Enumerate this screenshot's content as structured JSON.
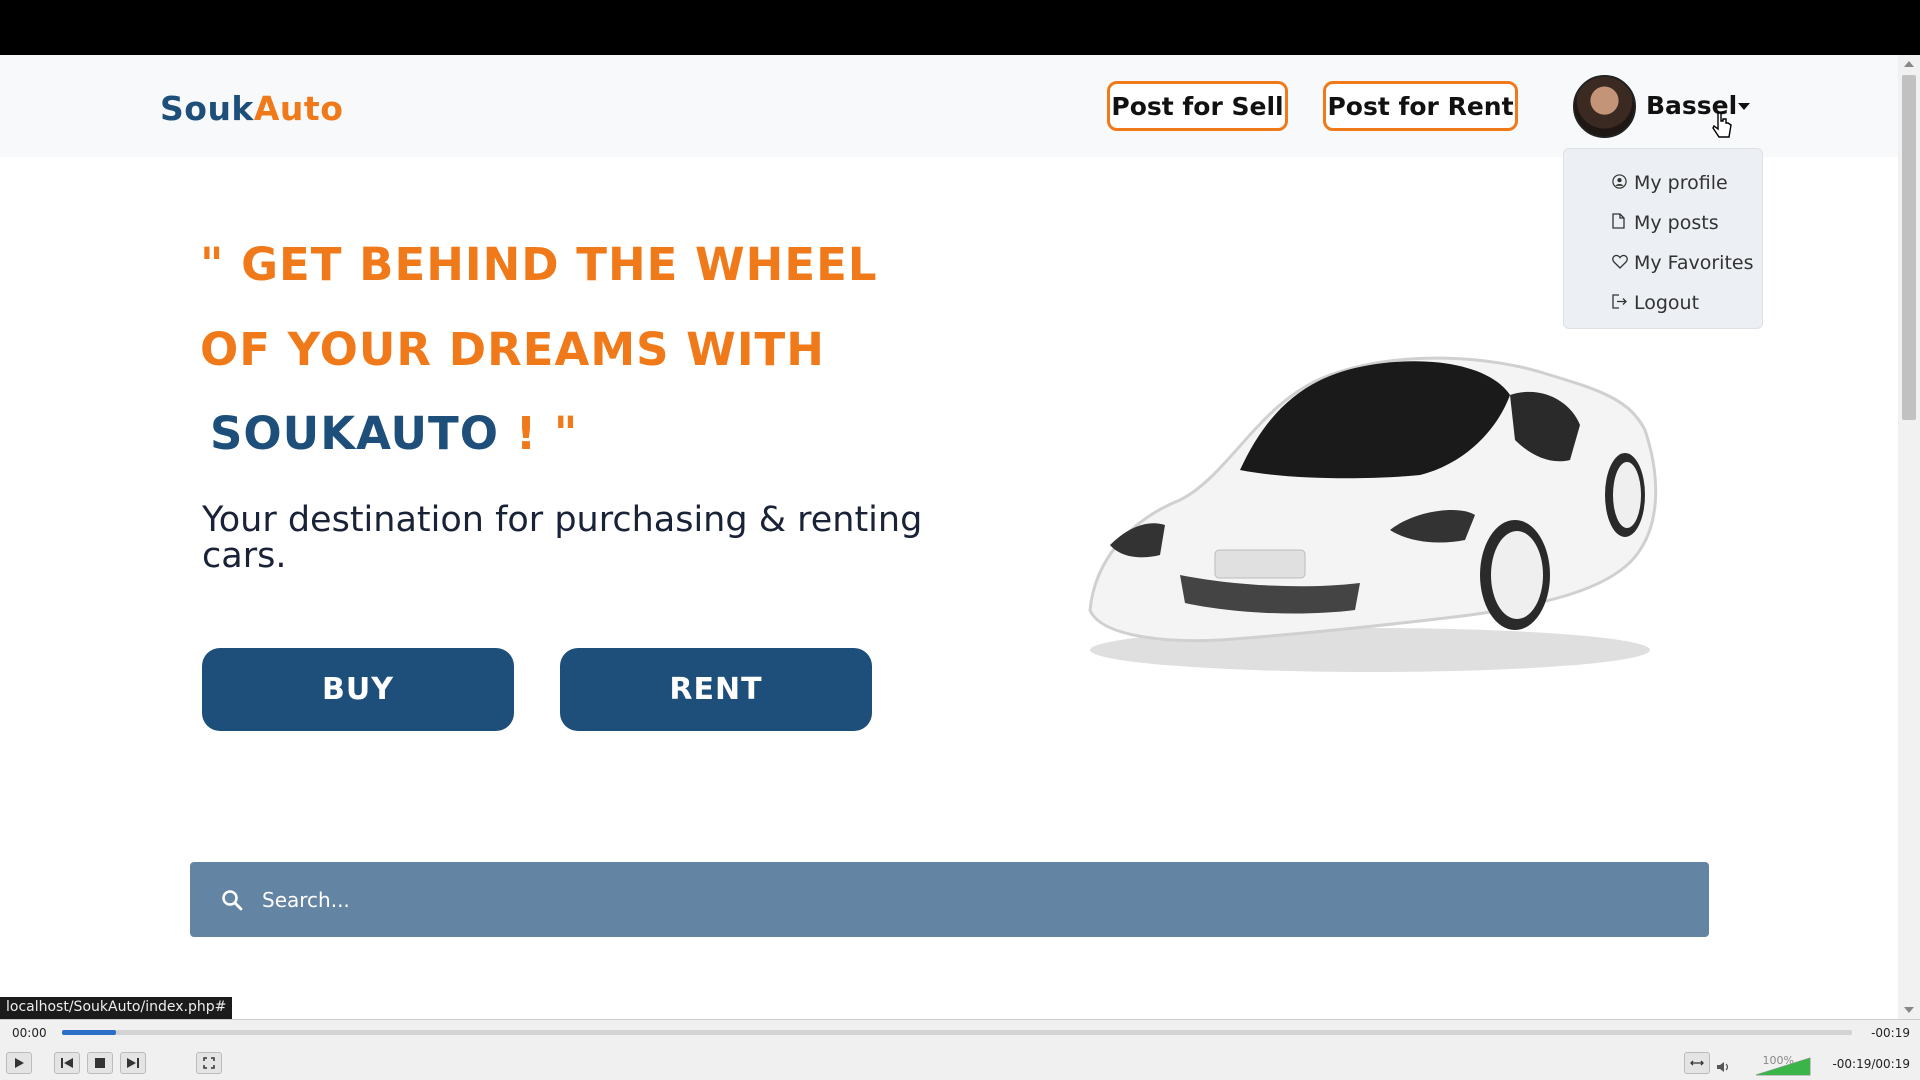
{
  "site": {
    "logo_part1": "Souk",
    "logo_part2": "Auto"
  },
  "navbar": {
    "post_sell": "Post for Sell",
    "post_rent": "Post for Rent",
    "user_name": "Bassel"
  },
  "dropdown": {
    "items": [
      {
        "icon": "user-circle-icon",
        "label": "My profile"
      },
      {
        "icon": "file-icon",
        "label": "My posts"
      },
      {
        "icon": "heart-icon",
        "label": "My Favorites"
      },
      {
        "icon": "logout-icon",
        "label": "Logout"
      }
    ]
  },
  "hero": {
    "line1": "\" GET BEHIND THE WHEEL",
    "line2": "OF YOUR DREAMS WITH",
    "brand": "SOUKAUTO",
    "excl": "!",
    "endquote": "\"",
    "tagline": "Your destination for purchasing & renting cars.",
    "buy": "BUY",
    "rent": "RENT"
  },
  "search": {
    "placeholder": "Search..."
  },
  "status_url": "localhost/SoukAuto/index.php#",
  "player": {
    "time_current": "00:00",
    "time_remaining": "-00:19",
    "time_total": "-00:19/00:19",
    "volume_label": "100%",
    "progress": 0.03,
    "volume": 1.0
  },
  "colors": {
    "brand_blue": "#1d4f7a",
    "brand_orange": "#f07a1a",
    "search_bg": "#6385a3"
  }
}
